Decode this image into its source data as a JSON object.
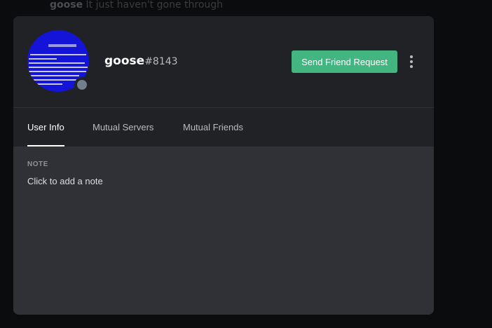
{
  "background_chat": {
    "author": "goose",
    "message": "It just haven't gone through"
  },
  "profile": {
    "username": "goose",
    "discriminator": "#8143",
    "status": "offline",
    "avatar_icon": "avatar-bluescreen-image"
  },
  "actions": {
    "send_friend_request_label": "Send Friend Request",
    "more_icon": "more-vertical-icon",
    "accent_color": "#43b581"
  },
  "tabs": [
    {
      "label": "User Info",
      "active": true
    },
    {
      "label": "Mutual Servers",
      "active": false
    },
    {
      "label": "Mutual Friends",
      "active": false
    }
  ],
  "user_info": {
    "note_label": "NOTE",
    "note_placeholder": "Click to add a note"
  }
}
